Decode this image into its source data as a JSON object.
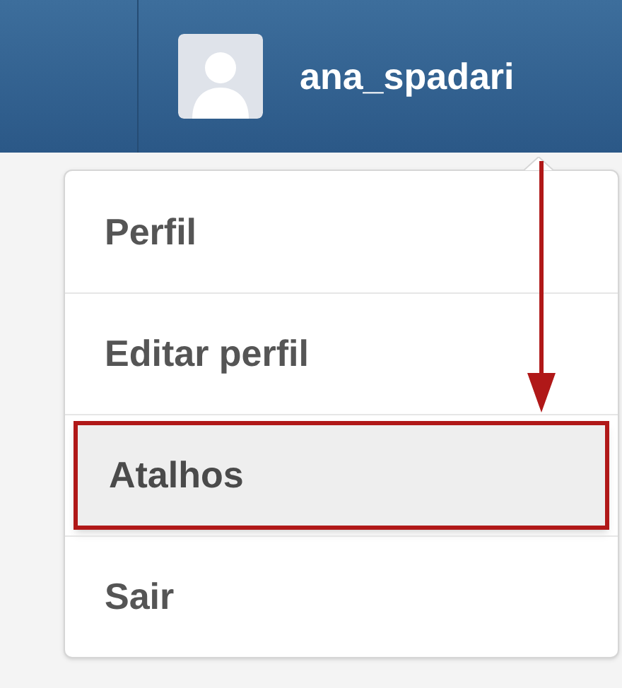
{
  "header": {
    "username": "ana_spadari"
  },
  "menu": [
    {
      "label": "Perfil",
      "selected": false,
      "annotated": false
    },
    {
      "label": "Editar perfil",
      "selected": false,
      "annotated": false
    },
    {
      "label": "Atalhos",
      "selected": true,
      "annotated": true
    },
    {
      "label": "Sair",
      "selected": false,
      "annotated": false
    }
  ]
}
